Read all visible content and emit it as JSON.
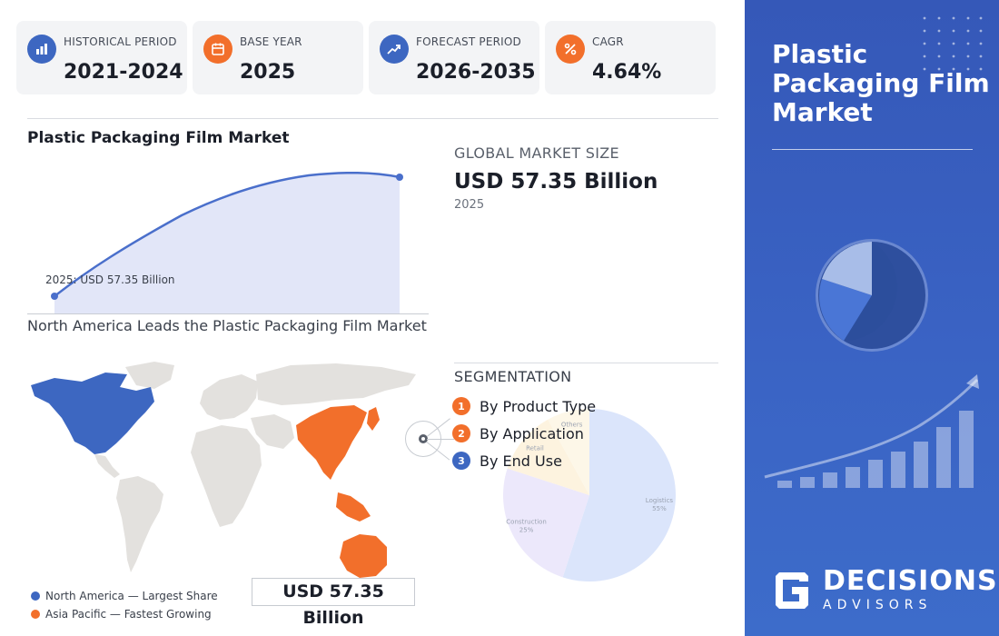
{
  "stats": [
    {
      "label": "HISTORICAL PERIOD",
      "value": "2021-2024",
      "icon": "bar-chart-icon",
      "color": "#3d67c1"
    },
    {
      "label": "BASE YEAR",
      "value": "2025",
      "icon": "calendar-icon",
      "color": "#f26f2b"
    },
    {
      "label": "FORECAST PERIOD",
      "value": "2026-2035",
      "icon": "trend-up-icon",
      "color": "#3d67c1"
    },
    {
      "label": "CAGR",
      "value": "4.64%",
      "icon": "percent-icon",
      "color": "#f26f2b"
    }
  ],
  "market_chart": {
    "title": "Plastic Packaging Film Market",
    "annotation": "2025: USD 57.35 Billion"
  },
  "global_market": {
    "label": "GLOBAL MARKET SIZE",
    "value": "USD 57.35 Billion",
    "year": "2025"
  },
  "map": {
    "title": "North America Leads the Plastic Packaging Film Market",
    "value": "USD 57.35 Billion",
    "legend": [
      {
        "label": "North America — Largest Share",
        "color": "#3d67c1"
      },
      {
        "label": "Asia Pacific — Fastest Growing",
        "color": "#f26f2b"
      }
    ]
  },
  "segmentation": {
    "title": "SEGMENTATION",
    "items": [
      {
        "number": "1",
        "label": "By Product Type",
        "color": "#f26f2b"
      },
      {
        "number": "2",
        "label": "By Application",
        "color": "#f26f2b"
      },
      {
        "number": "3",
        "label": "By End Use",
        "color": "#3d67c1"
      }
    ],
    "pie": [
      {
        "name": "Logistics",
        "share": 55,
        "label": "Logistics\n55%",
        "color": "#dbe5fb"
      },
      {
        "name": "Construction",
        "share": 25,
        "label": "Construction\n25%",
        "color": "#ece8fb"
      },
      {
        "name": "Retail",
        "share": 12,
        "label": "Retail",
        "color": "#fdf3df"
      },
      {
        "name": "Others",
        "share": 8,
        "label": "Others",
        "color": "#fdf7e8"
      }
    ]
  },
  "panel": {
    "title": "Plastic Packaging Film Market",
    "logo_word1": "DECISIONS",
    "logo_word2": "ADVISORS"
  },
  "colors": {
    "accent_blue": "#3d67c1",
    "accent_orange": "#f26f2b",
    "panel_blue": "#3a63c4"
  }
}
